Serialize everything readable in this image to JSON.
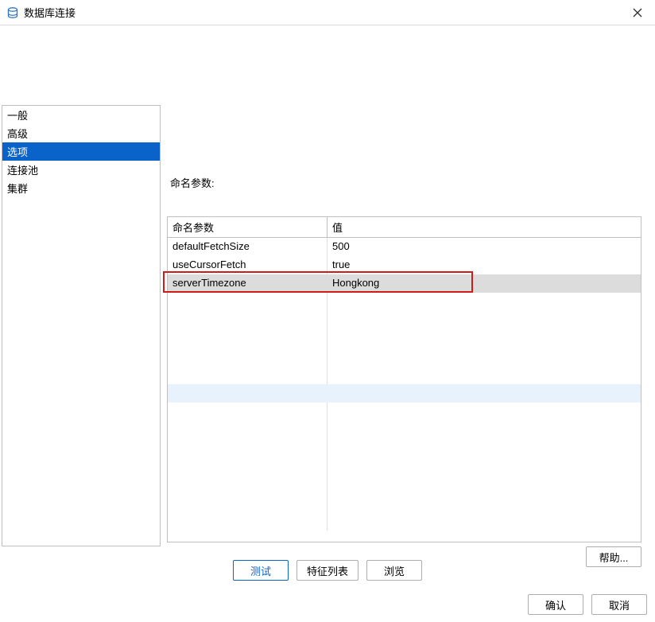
{
  "window": {
    "title": "数据库连接"
  },
  "sidebar": {
    "items": [
      {
        "label": "一般"
      },
      {
        "label": "高级"
      },
      {
        "label": "选项"
      },
      {
        "label": "连接池"
      },
      {
        "label": "集群"
      }
    ],
    "selected_index": 2
  },
  "section": {
    "label": "命名参数:"
  },
  "table": {
    "columns": {
      "name": "命名参数",
      "value": "值"
    },
    "rows": [
      {
        "name": "defaultFetchSize",
        "value": "500"
      },
      {
        "name": "useCursorFetch",
        "value": "true"
      },
      {
        "name": "serverTimezone",
        "value": "Hongkong"
      }
    ],
    "selected_index": 2,
    "highlight_index": 2,
    "hover_empty_row_index": 5
  },
  "buttons": {
    "help": "帮助...",
    "test": "测试",
    "feature_list": "特征列表",
    "browse": "浏览",
    "ok": "确认",
    "cancel": "取消"
  }
}
